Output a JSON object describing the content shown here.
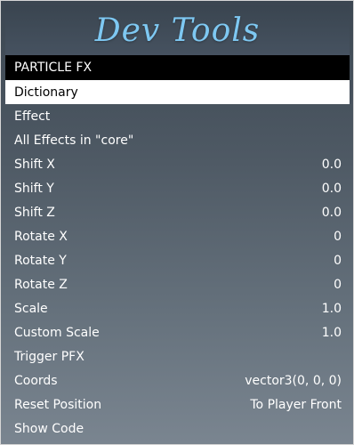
{
  "menu": {
    "title": "Dev Tools",
    "subtitle": "PARTICLE FX",
    "colors": {
      "title": "#7ec8f2",
      "selected_bg": "#ffffff",
      "subtitle_bg": "#000000"
    },
    "items": [
      {
        "label": "Dictionary",
        "value": ""
      },
      {
        "label": "Effect",
        "value": ""
      },
      {
        "label": "All Effects in \"core\"",
        "value": ""
      },
      {
        "label": "Shift X",
        "value": "0.0"
      },
      {
        "label": "Shift Y",
        "value": "0.0"
      },
      {
        "label": "Shift Z",
        "value": "0.0"
      },
      {
        "label": "Rotate X",
        "value": "0"
      },
      {
        "label": "Rotate Y",
        "value": "0"
      },
      {
        "label": "Rotate Z",
        "value": "0"
      },
      {
        "label": "Scale",
        "value": "1.0"
      },
      {
        "label": "Custom Scale",
        "value": "1.0"
      },
      {
        "label": "Trigger PFX",
        "value": ""
      },
      {
        "label": "Coords",
        "value": "vector3(0, 0, 0)"
      },
      {
        "label": "Reset Position",
        "value": "To Player Front"
      },
      {
        "label": "Show Code",
        "value": ""
      }
    ]
  }
}
